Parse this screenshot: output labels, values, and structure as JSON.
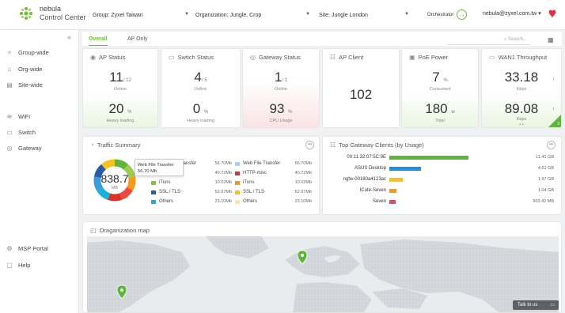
{
  "header": {
    "brand_line1": "nebula",
    "brand_line2": "Control Center",
    "group_label": "Group:",
    "group_value": "Zyxel Taiwan",
    "org_label": "Organization:",
    "org_value": "Jungle. Crop",
    "site_label": "Site:",
    "site_value": "Jungle London",
    "orchestrator_label": "Orchestrator",
    "user_email": "nebula@zyxel.com.tw ▾"
  },
  "sidebar": {
    "collapse": "«",
    "items": [
      {
        "label": "Group-wide",
        "icon": "group-icon"
      },
      {
        "label": "Org-wide",
        "icon": "building-icon"
      },
      {
        "label": "Site-wide",
        "icon": "site-icon"
      },
      {
        "label": "WiFi",
        "icon": "wifi-icon"
      },
      {
        "label": "Switch",
        "icon": "switch-icon"
      },
      {
        "label": "Gateway",
        "icon": "gateway-icon"
      },
      {
        "label": "MSP Portal",
        "icon": "msp-icon"
      },
      {
        "label": "Help",
        "icon": "help-icon"
      }
    ]
  },
  "tabs": [
    {
      "label": "Overall",
      "active": true
    },
    {
      "label": "AP Only",
      "active": false
    }
  ],
  "search": {
    "placeholder": "Search..."
  },
  "cards": {
    "ap_status": {
      "title": "AP Status",
      "value": "11",
      "total": "/ 12",
      "sub": "Online",
      "value2": "20",
      "unit2": "%",
      "sub2": "Heavy loading"
    },
    "switch_status": {
      "title": "Swtich Status",
      "value": "4",
      "total": "/ 5",
      "sub": "Online",
      "value2": "0",
      "unit2": "%",
      "sub2": "Heavy loading"
    },
    "gateway_status": {
      "title": "Gateway Status",
      "value": "1",
      "total": "/ 1",
      "sub": "Online",
      "value2": "93",
      "unit2": "%",
      "sub2": "CPU Usage"
    },
    "ap_client": {
      "title": "AP Client",
      "value": "102"
    },
    "poe_power": {
      "title": "PoE Power",
      "value": "7",
      "unit": "%",
      "sub": "Consumed",
      "value2": "180",
      "unit2": "w",
      "sub2": "Total"
    },
    "wan_throughput": {
      "title": "WAN1 Throughput",
      "value": "33.18",
      "sub": "Kbps",
      "value2": "89.08",
      "sub2": "Kbps",
      "dots": "• •",
      "corner": "3"
    }
  },
  "traffic": {
    "title": "Traffic Summary",
    "total": "838.7",
    "unit": "MB",
    "tooltip_line1": "Web File Transfer",
    "tooltip_line2": "56.70 Mb",
    "col1": [
      {
        "name": "Web File Transfer",
        "value": "56.70Mb",
        "color": "#3a9bdc"
      },
      {
        "name": "HTTP-misc",
        "value": "40.72Mb",
        "color": "#ea4a3f"
      },
      {
        "name": "iTuns",
        "value": "10.02Mb",
        "color": "#7dc242"
      },
      {
        "name": "SSL / TLS",
        "value": "52.07Mb",
        "color": "#2d5aa8"
      },
      {
        "name": "Others",
        "value": "23.10Mb",
        "color": "#1cb0d8"
      }
    ],
    "col2": [
      {
        "name": "Web File Transfer",
        "value": "56.70Mb",
        "color": "#a9d4f0"
      },
      {
        "name": "HTTP-misc",
        "value": "40.72Mb",
        "color": "#d9322a"
      },
      {
        "name": "iTuns",
        "value": "10.02Mb",
        "color": "#f39a1e"
      },
      {
        "name": "SSL / TLS",
        "value": "52.07Mb",
        "color": "#f6c21c"
      },
      {
        "name": "Others",
        "value": "23.10Mb",
        "color": "#f7e6a8"
      }
    ],
    "donut_colors": [
      "#5fb43a",
      "#9ccc4f",
      "#f39a1e",
      "#ea4a3f",
      "#d9322a",
      "#1cb0d8",
      "#3a9bdc",
      "#2d5aa8",
      "#f6c21c"
    ]
  },
  "top_clients": {
    "title": "Top Gateway Clients (by Usage)",
    "rows": [
      {
        "name": "00:11:32:07:5C:9E",
        "value": "11.41 GB",
        "fraction": 1.0,
        "color": "#5fb43a"
      },
      {
        "name": "ASUS Desktop",
        "value": "4.61 GB",
        "fraction": 0.404,
        "color": "#1e90e0"
      },
      {
        "name": "ngfw-00180a4123ac",
        "value": "1.97 GB",
        "fraction": 0.173,
        "color": "#f6c21c"
      },
      {
        "name": "ICute-Seven",
        "value": "1.04 GB",
        "fraction": 0.091,
        "color": "#f39a1e"
      },
      {
        "name": "Seven",
        "value": "903.42 MB",
        "fraction": 0.077,
        "color": "#ea4a6a"
      }
    ]
  },
  "map": {
    "title": "Oraganization map"
  },
  "talk": {
    "label": "Talk to us"
  }
}
